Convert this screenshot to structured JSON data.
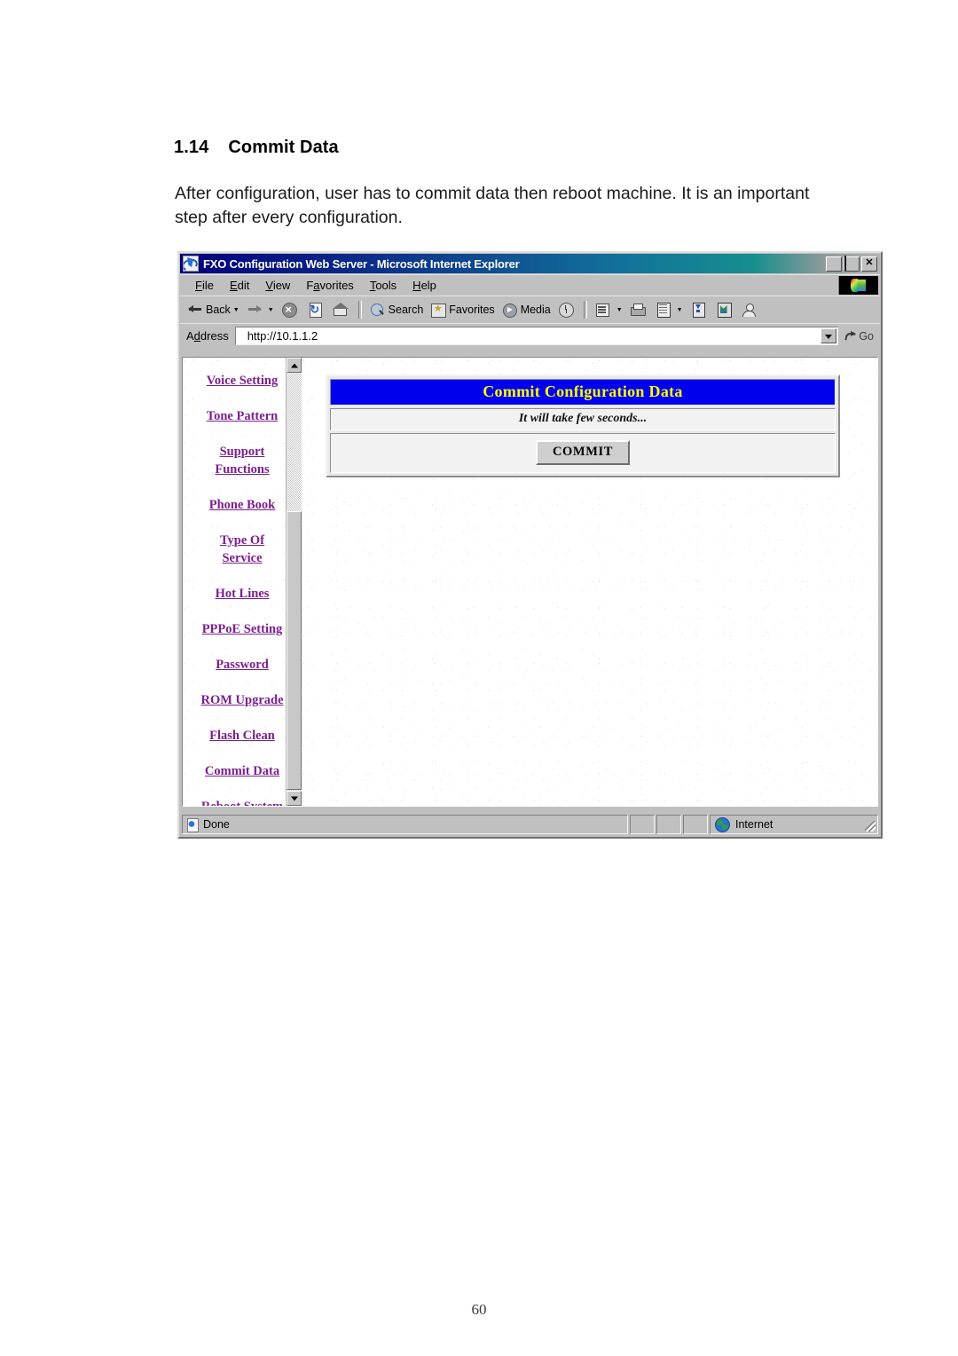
{
  "document": {
    "section_number": "1.14",
    "section_title": "Commit Data",
    "body_text": "After configuration, user has to commit data then reboot machine. It is an important step after every configuration.",
    "page_number": "60"
  },
  "browser": {
    "title": "FXO Configuration Web Server - Microsoft Internet Explorer",
    "window_controls": {
      "minimize": "_",
      "maximize": "□",
      "close": "✕"
    },
    "menu": [
      "File",
      "Edit",
      "View",
      "Favorites",
      "Tools",
      "Help"
    ],
    "toolbar": [
      {
        "label": "Back",
        "icon": "back-arrow-icon",
        "has_dropdown": true
      },
      {
        "label": "",
        "icon": "forward-arrow-icon",
        "has_dropdown": true
      },
      {
        "label": "",
        "icon": "stop-icon",
        "has_dropdown": false
      },
      {
        "label": "",
        "icon": "refresh-icon",
        "has_dropdown": false
      },
      {
        "label": "",
        "icon": "home-icon",
        "has_dropdown": false
      },
      {
        "label": "Search",
        "icon": "search-icon",
        "has_dropdown": false
      },
      {
        "label": "Favorites",
        "icon": "favorites-icon",
        "has_dropdown": false
      },
      {
        "label": "Media",
        "icon": "media-icon",
        "has_dropdown": false
      },
      {
        "label": "",
        "icon": "history-icon",
        "has_dropdown": false
      },
      {
        "label": "",
        "icon": "mail-icon",
        "has_dropdown": true
      },
      {
        "label": "",
        "icon": "print-icon",
        "has_dropdown": false
      },
      {
        "label": "",
        "icon": "edit-icon",
        "has_dropdown": true
      },
      {
        "label": "",
        "icon": "discuss-icon",
        "has_dropdown": false
      },
      {
        "label": "",
        "icon": "messenger-icon",
        "has_dropdown": false
      },
      {
        "label": "",
        "icon": "person-icon",
        "has_dropdown": false
      }
    ],
    "address": {
      "label": "Address",
      "value": "http://10.1.1.2",
      "placeholder": "http://",
      "go_label": "Go"
    },
    "status": {
      "text": "Done",
      "zone": "Internet"
    }
  },
  "sidebar": {
    "items": [
      {
        "label": "Voice Setting",
        "lines": [
          "Voice Setting"
        ]
      },
      {
        "label": "Tone Pattern",
        "lines": [
          "Tone Pattern"
        ]
      },
      {
        "label": "Support Functions",
        "lines": [
          "Support",
          "Functions"
        ]
      },
      {
        "label": "Phone Book",
        "lines": [
          "Phone Book"
        ]
      },
      {
        "label": "Type Of Service",
        "lines": [
          "Type Of",
          "Service"
        ]
      },
      {
        "label": "Hot Lines",
        "lines": [
          "Hot Lines"
        ]
      },
      {
        "label": "PPPoE Setting",
        "lines": [
          "PPPoE Setting"
        ]
      },
      {
        "label": "Password",
        "lines": [
          "Password"
        ]
      },
      {
        "label": "ROM Upgrade",
        "lines": [
          "ROM Upgrade"
        ]
      },
      {
        "label": "Flash Clean",
        "lines": [
          "Flash Clean"
        ]
      },
      {
        "label": "Commit Data",
        "lines": [
          "Commit Data"
        ]
      },
      {
        "label": "Reboot System",
        "lines": [
          "Reboot System"
        ]
      }
    ],
    "link_color": "#7b1f8f"
  },
  "main": {
    "panel_title": "Commit Configuration Data",
    "panel_note": "It will take few seconds...",
    "commit_button_label": "COMMIT",
    "title_bg_color": "#0000ee",
    "title_text_color": "#ffff00"
  }
}
